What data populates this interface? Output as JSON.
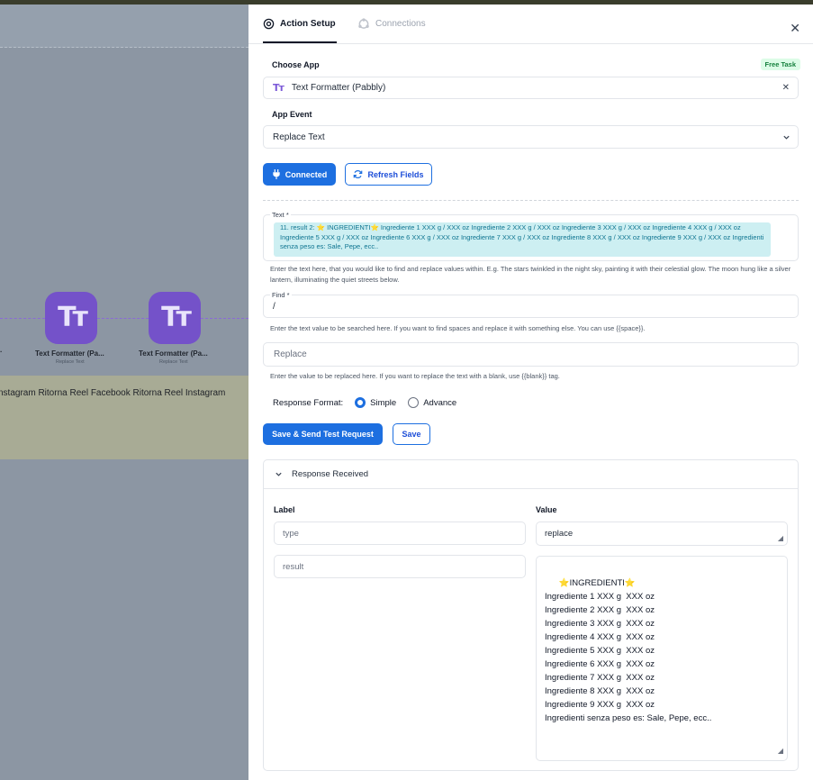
{
  "canvas": {
    "trail_text": ".",
    "nodes": [
      {
        "icon": "Tт",
        "title": "Text Formatter (Pa...",
        "subtitle": "Replace Text"
      },
      {
        "icon": "Tт",
        "title": "Text Formatter (Pa...",
        "subtitle": "Replace Text"
      }
    ],
    "note_text": "nstagram Ritorna Reel Facebook Ritorna Reel Instagram"
  },
  "panel": {
    "tabs": [
      {
        "label": "Action Setup",
        "active": true
      },
      {
        "label": "Connections",
        "active": false
      }
    ],
    "choose_app": {
      "label": "Choose App",
      "badge": "Free Task",
      "value": "Text Formatter (Pabbly)"
    },
    "app_event": {
      "label": "App Event",
      "value": "Replace Text"
    },
    "buttons": {
      "connected": "Connected",
      "refresh": "Refresh Fields",
      "save_send": "Save & Send Test Request",
      "save": "Save"
    },
    "text_field": {
      "label": "Text *",
      "chip": "11. result 2: ⭐ INGREDIENTI⭐ Ingrediente 1 XXX g / XXX oz Ingrediente 2 XXX g / XXX oz Ingrediente 3 XXX g / XXX oz Ingrediente 4 XXX g / XXX oz Ingrediente 5 XXX g / XXX oz Ingrediente 6 XXX g / XXX oz Ingrediente 7 XXX g / XXX oz Ingrediente 8 XXX g / XXX oz Ingrediente 9 XXX g / XXX oz Ingredienti senza peso es: Sale, Pepe, ecc..",
      "help": "Enter the text here, that you would like to find and replace values within. E.g. The stars twinkled in the night sky, painting it with their celestial glow. The moon hung like a silver lantern, illuminating the quiet streets below."
    },
    "find_field": {
      "label": "Find *",
      "value": "/",
      "help": "Enter the text value to be searched here. If you want to find spaces and replace it with something else. You can use {{space}}."
    },
    "replace_field": {
      "placeholder": "Replace",
      "help": "Enter the value to be replaced here. If you want to replace the text with a blank, use {{blank}} tag."
    },
    "response_format": {
      "label": "Response Format:",
      "options": [
        "Simple",
        "Advance"
      ],
      "selected": "Simple"
    },
    "response": {
      "title": "Response Received",
      "label_header": "Label",
      "value_header": "Value",
      "rows": [
        {
          "label": "type",
          "value": "replace"
        },
        {
          "label": "result",
          "value": "⭐INGREDIENTI⭐\nIngrediente 1 XXX g  XXX oz\nIngrediente 2 XXX g  XXX oz\nIngrediente 3 XXX g  XXX oz\nIngrediente 4 XXX g  XXX oz\nIngrediente 5 XXX g  XXX oz\nIngrediente 6 XXX g  XXX oz\nIngrediente 7 XXX g  XXX oz\nIngrediente 8 XXX g  XXX oz\nIngrediente 9 XXX g  XXX oz\nIngredienti senza peso es: Sale, Pepe, ecc.."
        }
      ]
    }
  }
}
